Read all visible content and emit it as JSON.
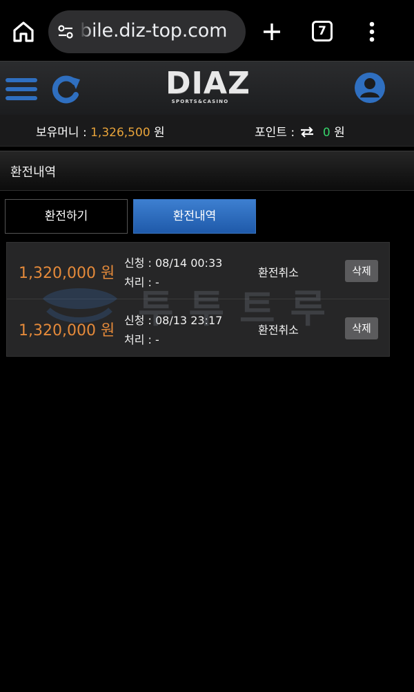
{
  "browser": {
    "url": "bile.diz-top.com",
    "tab_count": "7",
    "icons": [
      "home-icon",
      "tune-icon",
      "plus-icon",
      "tabs-icon",
      "kebab-menu-icon"
    ]
  },
  "header": {
    "logo_main": "DIAZ",
    "logo_sub": "SPORTS&CASINO",
    "icons": [
      "hamburger-icon",
      "refresh-icon",
      "user-icon"
    ]
  },
  "balance": {
    "money_label": "보유머니 :",
    "money_value": "1,326,500",
    "money_unit": "원",
    "point_label": "포인트 :",
    "point_value": "0",
    "point_unit": "원"
  },
  "section": {
    "title": "환전내역"
  },
  "tabs": [
    {
      "label": "환전하기",
      "active": false
    },
    {
      "label": "환전내역",
      "active": true
    }
  ],
  "transactions": [
    {
      "amount": "1,320,000 원",
      "request": "신청 : 08/14 00:33",
      "processed": "처리 : -",
      "status": "환전취소",
      "delete_label": "삭제"
    },
    {
      "amount": "1,320,000 원",
      "request": "신청 : 08/13 23:17",
      "processed": "처리 : -",
      "status": "환전취소",
      "delete_label": "삭제"
    }
  ],
  "watermark": "투투트루",
  "colors": {
    "accent": "#2f6fc0",
    "amount": "#e58a3a",
    "money": "#e9a43a",
    "point": "#36d36a"
  }
}
